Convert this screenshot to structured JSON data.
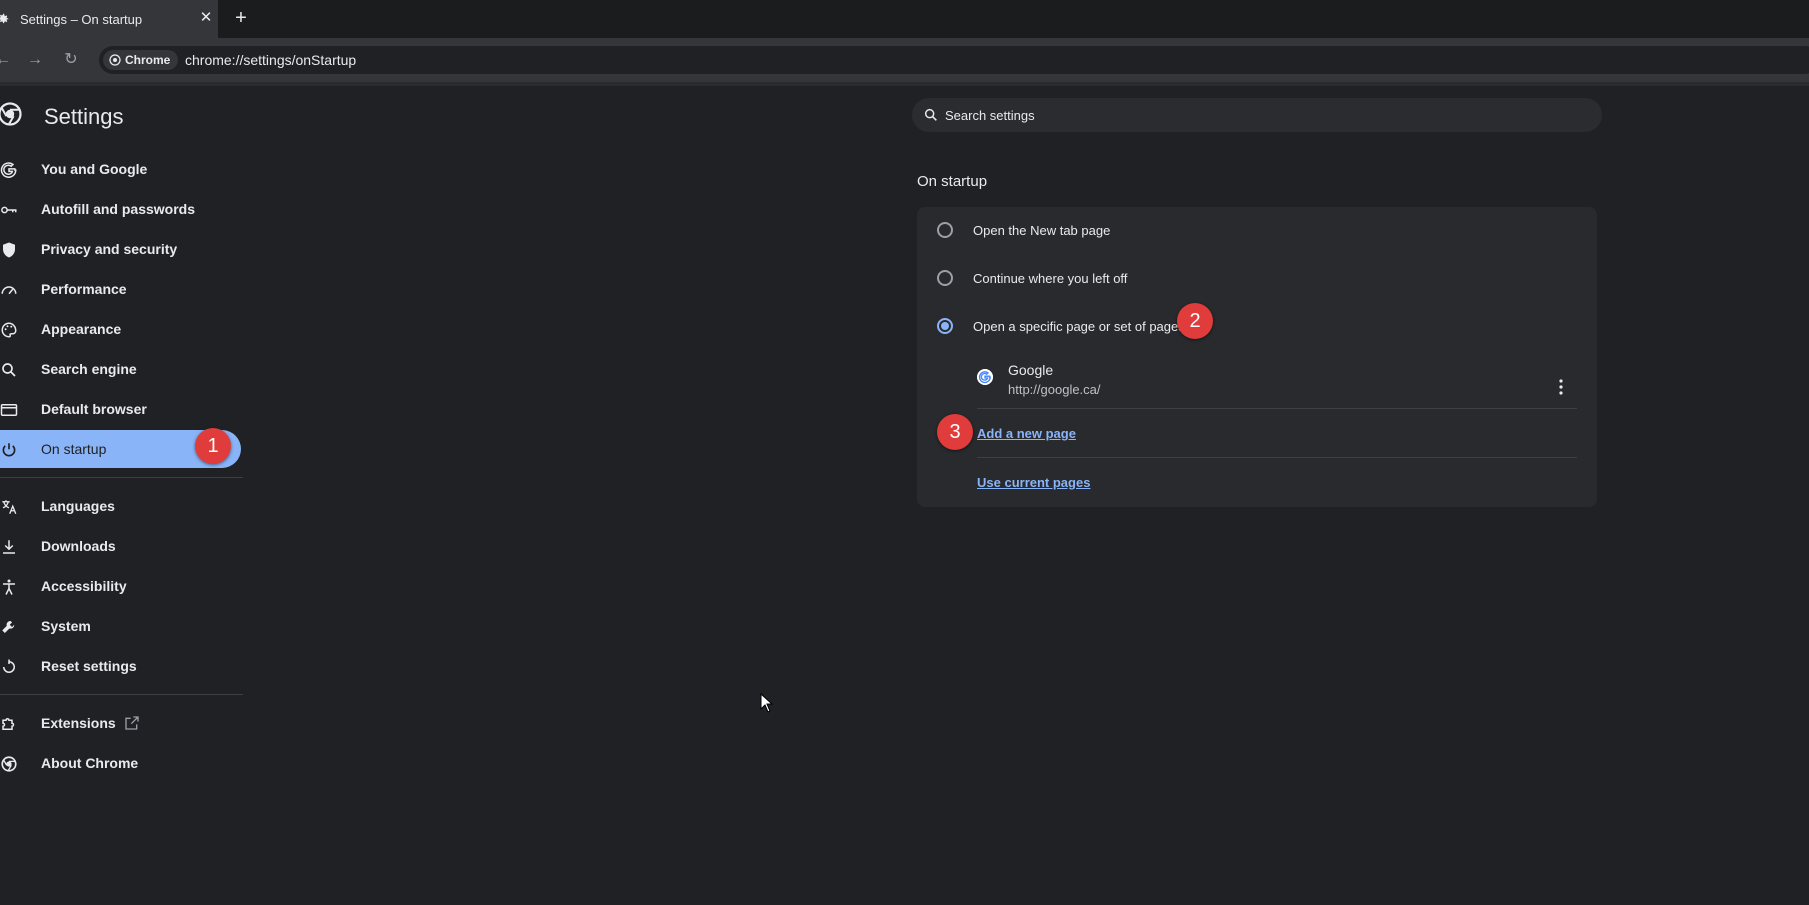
{
  "browser": {
    "tab_title": "Settings – On startup",
    "new_tab_symbol": "+",
    "close_symbol": "✕",
    "site_chip": "Chrome",
    "url": "chrome://settings/onStartup"
  },
  "sidebar": {
    "title": "Settings",
    "items": [
      {
        "label": "You and Google",
        "icon": "google-g-icon"
      },
      {
        "label": "Autofill and passwords",
        "icon": "key-icon"
      },
      {
        "label": "Privacy and security",
        "icon": "shield-icon"
      },
      {
        "label": "Performance",
        "icon": "speedometer-icon"
      },
      {
        "label": "Appearance",
        "icon": "palette-icon"
      },
      {
        "label": "Search engine",
        "icon": "search-icon"
      },
      {
        "label": "Default browser",
        "icon": "browser-window-icon"
      },
      {
        "label": "On startup",
        "icon": "power-icon",
        "active": true
      },
      {
        "label": "Languages",
        "icon": "translate-icon"
      },
      {
        "label": "Downloads",
        "icon": "download-icon"
      },
      {
        "label": "Accessibility",
        "icon": "accessibility-icon"
      },
      {
        "label": "System",
        "icon": "wrench-icon"
      },
      {
        "label": "Reset settings",
        "icon": "reset-icon"
      },
      {
        "label": "Extensions",
        "icon": "puzzle-icon"
      },
      {
        "label": "About Chrome",
        "icon": "chrome-icon"
      }
    ]
  },
  "search": {
    "placeholder": "Search settings"
  },
  "on_startup": {
    "section_title": "On startup",
    "options": [
      {
        "label": "Open the New tab page",
        "checked": false
      },
      {
        "label": "Continue where you left off",
        "checked": false
      },
      {
        "label": "Open a specific page or set of pages",
        "checked": true
      }
    ],
    "pages": [
      {
        "name": "Google",
        "url": "http://google.ca/"
      }
    ],
    "add_page_link": "Add a new page",
    "use_current_link": "Use current pages"
  },
  "annotations": {
    "badge1": "1",
    "badge2": "2",
    "badge3": "3"
  },
  "colors": {
    "accent": "#8ab4f8",
    "background": "#202124",
    "card": "#292a2d",
    "badge": "#e03c3c"
  }
}
